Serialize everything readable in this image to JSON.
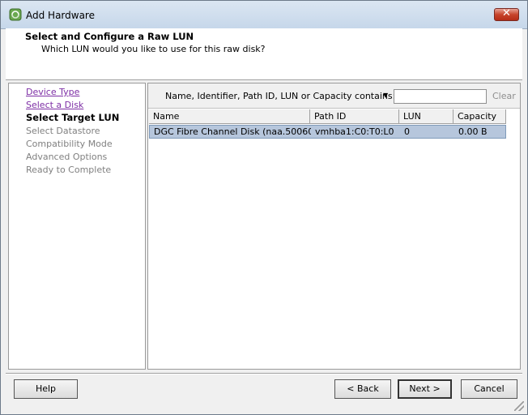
{
  "window": {
    "title": "Add Hardware",
    "close_label": "✕"
  },
  "header": {
    "title": "Select and Configure a Raw LUN",
    "subtitle": "Which LUN would you like to use for this raw disk?"
  },
  "steps": [
    {
      "label": "Device Type",
      "state": "link"
    },
    {
      "label": "Select a Disk",
      "state": "link"
    },
    {
      "label": "Select Target LUN",
      "state": "current"
    },
    {
      "label": "Select Datastore",
      "state": "disabled"
    },
    {
      "label": "Compatibility Mode",
      "state": "disabled"
    },
    {
      "label": "Advanced Options",
      "state": "disabled"
    },
    {
      "label": "Ready to Complete",
      "state": "disabled"
    }
  ],
  "filter": {
    "label": "Name, Identifier, Path ID, LUN or Capacity contains:",
    "value": "",
    "clear_label": "Clear"
  },
  "table": {
    "columns": [
      "Name",
      "Path ID",
      "LUN",
      "Capacity"
    ],
    "rows": [
      {
        "name": "DGC Fibre Channel Disk (naa.50060...",
        "path_id": "vmhba1:C0:T0:L0",
        "lun": "0",
        "capacity": "0.00 B"
      }
    ]
  },
  "buttons": {
    "help": "Help",
    "back": "< Back",
    "next": "Next >",
    "cancel": "Cancel"
  }
}
